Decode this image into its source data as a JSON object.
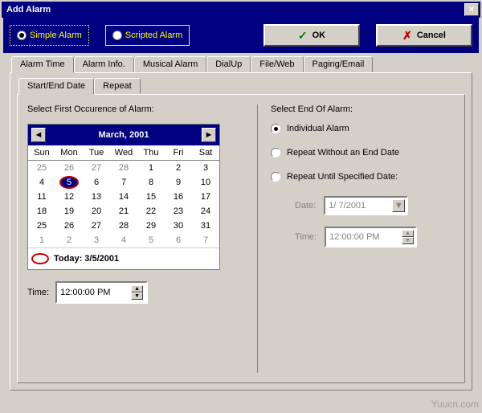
{
  "window": {
    "title": "Add Alarm"
  },
  "top": {
    "simple_alarm": "Simple Alarm",
    "scripted_alarm": "Scripted Alarm",
    "ok": "OK",
    "cancel": "Cancel",
    "selected": "simple"
  },
  "tabs": [
    "Alarm Time",
    "Alarm Info.",
    "Musical Alarm",
    "DialUp",
    "File/Web",
    "Paging/Email"
  ],
  "active_tab": 0,
  "subtabs": [
    "Start/End Date",
    "Repeat"
  ],
  "active_subtab": 0,
  "first": {
    "title": "Select First Occurence of Alarm:",
    "month_label": "March, 2001",
    "days": [
      "Sun",
      "Mon",
      "Tue",
      "Wed",
      "Thu",
      "Fri",
      "Sat"
    ],
    "grid": [
      [
        {
          "n": "25",
          "g": true
        },
        {
          "n": "26",
          "g": true
        },
        {
          "n": "27",
          "g": true
        },
        {
          "n": "28",
          "g": true
        },
        {
          "n": "1"
        },
        {
          "n": "2"
        },
        {
          "n": "3"
        }
      ],
      [
        {
          "n": "4"
        },
        {
          "n": "5",
          "sel": true
        },
        {
          "n": "6"
        },
        {
          "n": "7"
        },
        {
          "n": "8"
        },
        {
          "n": "9"
        },
        {
          "n": "10"
        }
      ],
      [
        {
          "n": "11"
        },
        {
          "n": "12"
        },
        {
          "n": "13"
        },
        {
          "n": "14"
        },
        {
          "n": "15"
        },
        {
          "n": "16"
        },
        {
          "n": "17"
        }
      ],
      [
        {
          "n": "18"
        },
        {
          "n": "19"
        },
        {
          "n": "20"
        },
        {
          "n": "21"
        },
        {
          "n": "22"
        },
        {
          "n": "23"
        },
        {
          "n": "24"
        }
      ],
      [
        {
          "n": "25"
        },
        {
          "n": "26"
        },
        {
          "n": "27"
        },
        {
          "n": "28"
        },
        {
          "n": "29"
        },
        {
          "n": "30"
        },
        {
          "n": "31"
        }
      ],
      [
        {
          "n": "1",
          "g": true
        },
        {
          "n": "2",
          "g": true
        },
        {
          "n": "3",
          "g": true
        },
        {
          "n": "4",
          "g": true
        },
        {
          "n": "5",
          "g": true
        },
        {
          "n": "6",
          "g": true
        },
        {
          "n": "7",
          "g": true
        }
      ]
    ],
    "today_label": "Today: 3/5/2001",
    "time_label": "Time:",
    "time_value": "12:00:00 PM"
  },
  "end": {
    "title": "Select End Of Alarm:",
    "options": {
      "individual": "Individual Alarm",
      "no_end": "Repeat Without an End Date",
      "until": "Repeat Until Specified Date:"
    },
    "selected": "individual",
    "date_label": "Date:",
    "date_value": "1/ 7/2001",
    "time_label": "Time:",
    "time_value": "12:00:00 PM"
  },
  "watermark": "Yuucn.com"
}
